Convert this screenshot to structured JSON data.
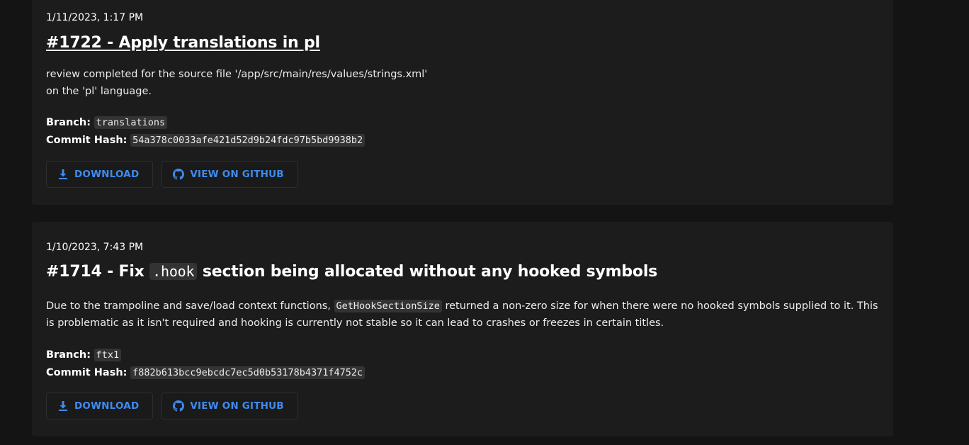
{
  "entries": [
    {
      "date": "1/11/2023, 1:17 PM",
      "title": "#1722 - Apply translations in pl",
      "description_line1": "review completed for the source file '/app/src/main/res/values/strings.xml'",
      "description_line2": "on the 'pl' language.",
      "branch_label": "Branch:",
      "branch": "translations",
      "commit_label": "Commit Hash:",
      "commit": "54a378c0033afe421d52d9b24fdc97b5bd9938b2",
      "download_label": "DOWNLOAD",
      "github_label": "VIEW ON GITHUB"
    },
    {
      "date": "1/10/2023, 7:43 PM",
      "title_prefix": "#1714 - Fix",
      "title_code": ".hook",
      "title_suffix": "section being allocated without any hooked symbols",
      "desc_part1": "Due to the trampoline and save/load context functions,",
      "desc_code": "GetHookSectionSize",
      "desc_part2": "returned a non-zero size for when there were no hooked symbols supplied to it. This is problematic as it isn't required and hooking is currently not stable so it can lead to crashes or freezes in certain titles.",
      "branch_label": "Branch:",
      "branch": "ftx1",
      "commit_label": "Commit Hash:",
      "commit": "f882b613bcc9ebcdc7ec5d0b53178b4371f4752c",
      "download_label": "DOWNLOAD",
      "github_label": "VIEW ON GITHUB"
    }
  ],
  "colors": {
    "page_bg": "#141414",
    "card_bg": "#1c1c1c",
    "accent": "#3f8bf0",
    "code_bg": "#333333"
  },
  "icons": {
    "download": "download-icon",
    "github": "github-icon"
  }
}
